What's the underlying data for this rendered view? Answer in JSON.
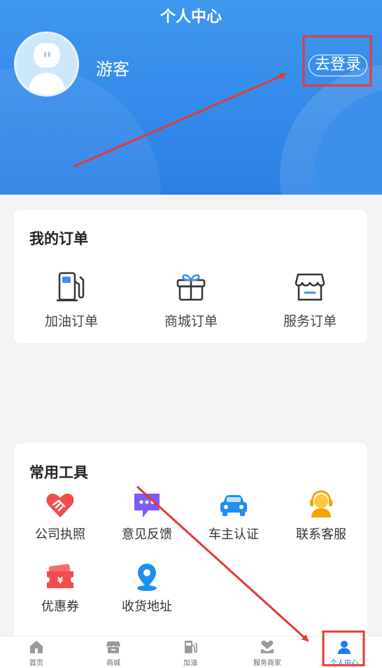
{
  "header": {
    "title": "个人中心",
    "username": "游客",
    "login_label": "去登录"
  },
  "orders": {
    "title": "我的订单",
    "items": [
      {
        "label": "加油订单",
        "icon": "fuel-pump-icon"
      },
      {
        "label": "商城订单",
        "icon": "gift-icon"
      },
      {
        "label": "服务订单",
        "icon": "shop-icon"
      }
    ]
  },
  "tools": {
    "title": "常用工具",
    "items": [
      {
        "label": "公司执照",
        "icon": "handshake-icon"
      },
      {
        "label": "意见反馈",
        "icon": "chat-bubble-icon"
      },
      {
        "label": "车主认证",
        "icon": "car-icon"
      },
      {
        "label": "联系客服",
        "icon": "headset-icon"
      },
      {
        "label": "优惠券",
        "icon": "coupon-icon"
      },
      {
        "label": "收货地址",
        "icon": "location-pin-icon"
      }
    ]
  },
  "tabbar": {
    "items": [
      {
        "label": "首页",
        "icon": "home-icon"
      },
      {
        "label": "商城",
        "icon": "store-icon"
      },
      {
        "label": "加油",
        "icon": "fuel-pump-icon"
      },
      {
        "label": "服务商家",
        "icon": "heart-hand-icon"
      },
      {
        "label": "个人中心",
        "icon": "person-icon",
        "active": true
      }
    ]
  },
  "colors": {
    "header_blue": "#2a7fe6",
    "active_tab": "#1a7fe6",
    "annotation_red": "#e53935"
  }
}
